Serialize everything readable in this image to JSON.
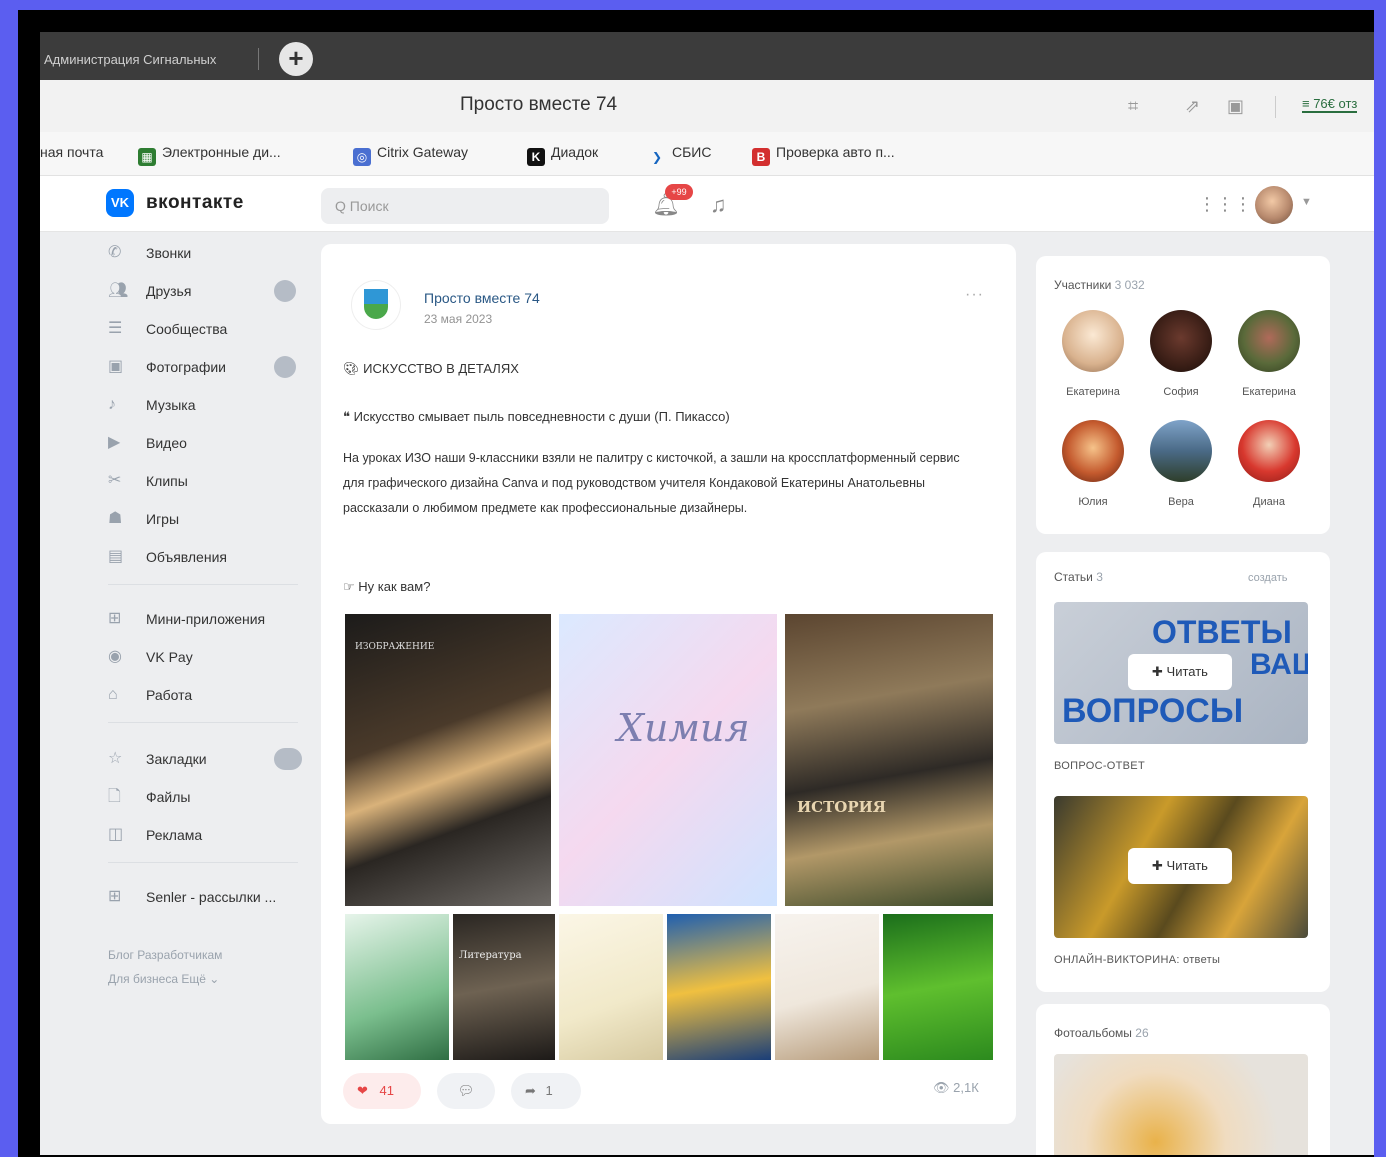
{
  "browser": {
    "tab_title": "Администрация Сигнальных",
    "new_tab_label": "+",
    "window_title": "Просто вместе 74",
    "extension_label": "≡ 76€ отз",
    "bookmarks": [
      {
        "label": "ная почта",
        "icon": "",
        "color": ""
      },
      {
        "label": "Электронные ди...",
        "icon": "edu",
        "color": "#2e7d32"
      },
      {
        "label": "Citrix Gateway",
        "icon": "citrix",
        "color": "#4a6fd1"
      },
      {
        "label": "Диадок",
        "icon": "K",
        "color": "#111111"
      },
      {
        "label": "СБИС",
        "icon": "sbis",
        "color": "#1565c0"
      },
      {
        "label": "Проверка авто п...",
        "icon": "В",
        "color": "#d32f2f"
      }
    ]
  },
  "vk_header": {
    "logo_text": "VK",
    "brand": "вконтакте",
    "search_placeholder": "Q  Поиск",
    "notification_count": "+99"
  },
  "sidebar": {
    "items": [
      {
        "label": "Звонки",
        "icon": "phone-icon"
      },
      {
        "label": "Друзья",
        "icon": "friends-icon",
        "badge": true
      },
      {
        "label": "Сообщества",
        "icon": "communities-icon"
      },
      {
        "label": "Фотографии",
        "icon": "photo-icon",
        "badge": true
      },
      {
        "label": "Музыка",
        "icon": "music-icon"
      },
      {
        "label": "Видео",
        "icon": "video-icon"
      },
      {
        "label": "Клипы",
        "icon": "clips-icon"
      },
      {
        "label": "Игры",
        "icon": "games-icon"
      },
      {
        "label": "Объявления",
        "icon": "ads-icon"
      },
      {
        "label": "Мини-приложения",
        "icon": "apps-icon"
      },
      {
        "label": "VK Pay",
        "icon": "vkpay-icon"
      },
      {
        "label": "Работа",
        "icon": "work-icon"
      },
      {
        "label": "Закладки",
        "icon": "bookmark-icon",
        "badge": true
      },
      {
        "label": "Файлы",
        "icon": "files-icon"
      },
      {
        "label": "Реклама",
        "icon": "advert-icon"
      },
      {
        "label": "Senler - рассылки ...",
        "icon": "senler-icon"
      }
    ],
    "footer_line1": "Блог   Разработчикам",
    "footer_line2": "Для бизнеса   Ещё ⌄"
  },
  "post": {
    "author": "Просто вместе 74",
    "date": "23 мая 2023",
    "heading": "ИСКУССТВО В ДЕТАЛЯХ",
    "quote": "Искусство смывает пыль повседневности с души (П. Пикассо)",
    "body": "На уроках ИЗО наши 9-классники взяли не палитру с кисточкой, а зашли на кроссплатформенный сервис для графического дизайна Canva и под руководством учителя Кондаковой Екатерины Анатольевны рассказали о любимом предмете как профессиональные дизайнеры.",
    "closing": "Ну как вам?",
    "photos": [
      {
        "label": "ИЗОБРАЖЕНИЕ"
      },
      {
        "label": "Химия"
      },
      {
        "label": "ИСТОРИЯ"
      },
      {
        "label": ""
      },
      {
        "label": "Литература"
      },
      {
        "label": ""
      },
      {
        "label": ""
      },
      {
        "label": ""
      },
      {
        "label": ""
      }
    ],
    "likes": "41",
    "reposts": "1",
    "views": "👁 2,1К"
  },
  "right": {
    "members_title": "Участники",
    "members_count": "3 032",
    "members": [
      {
        "name": "Екатерина"
      },
      {
        "name": "София"
      },
      {
        "name": "Екатерина"
      },
      {
        "name": "Юлия"
      },
      {
        "name": "Вера"
      },
      {
        "name": "Диана"
      }
    ],
    "articles_title": "Статьи",
    "articles_count": "3",
    "articles_link": "создать",
    "articles": [
      {
        "caption": "ВОПРОС-ОТВЕТ",
        "button": "Читать",
        "headline_1": "ОТВЕТЫ",
        "headline_2": "ВОПРОСЫ",
        "headline_3": "ВАШИ"
      },
      {
        "caption": "ОНЛАЙН-ВИКТОРИНА: ответы",
        "button": "Читать"
      }
    ],
    "albums_title": "Фотоальбомы",
    "albums_count": "26"
  }
}
